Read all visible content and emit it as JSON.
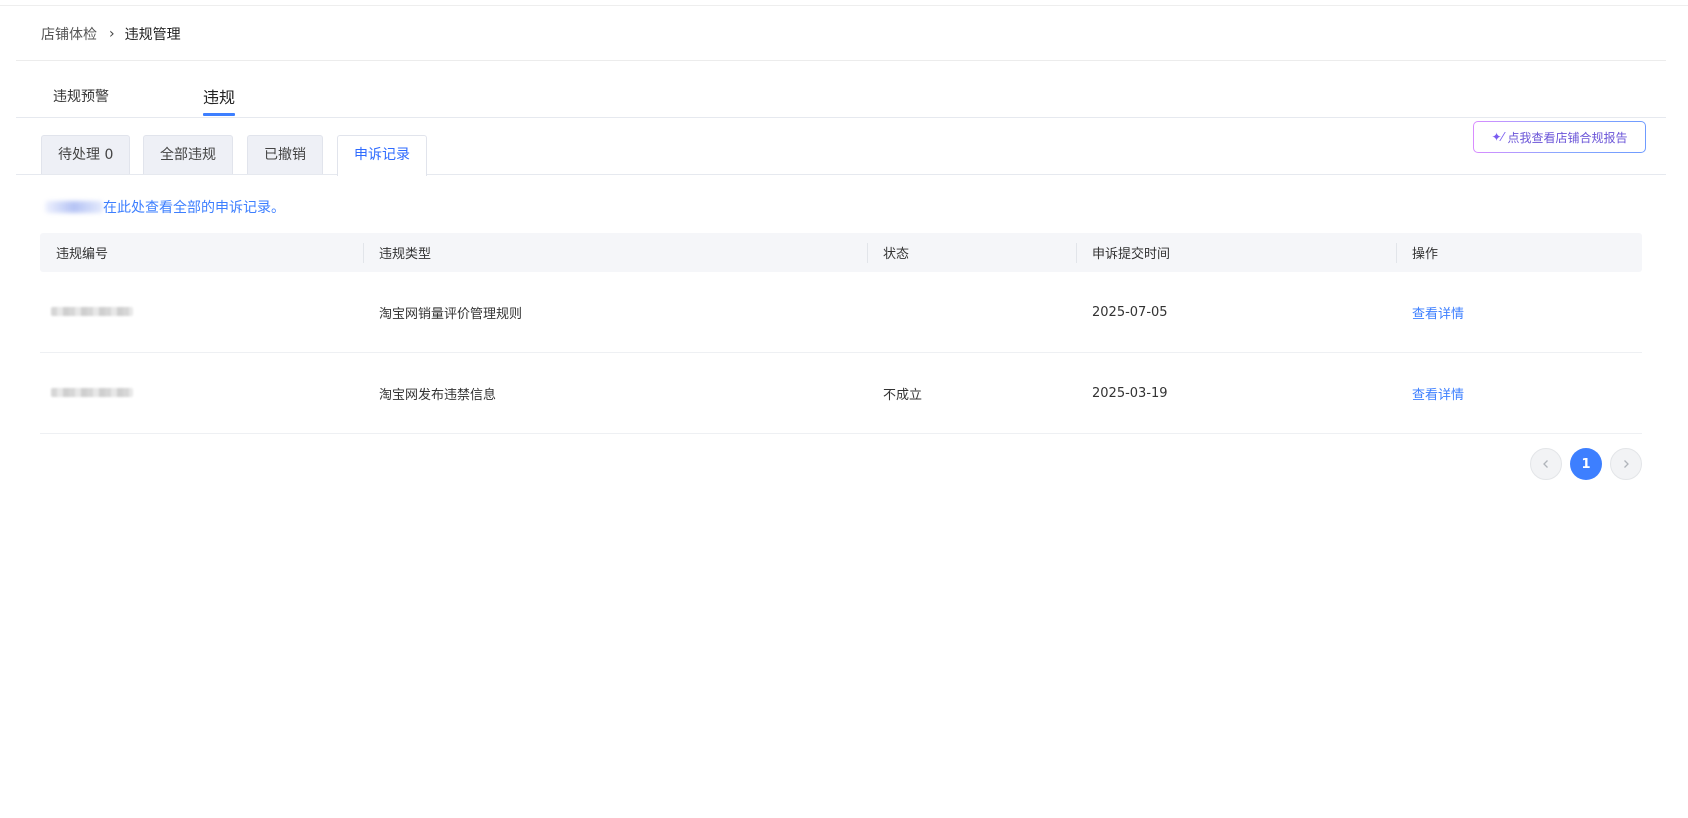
{
  "breadcrumb": {
    "parent": "店铺体检",
    "separator": "›",
    "current": "违规管理"
  },
  "main_tabs": [
    {
      "label": "违规预警",
      "active": false
    },
    {
      "label": "违规",
      "active": true
    }
  ],
  "sub_tabs": [
    {
      "label": "待处理 0",
      "active": false
    },
    {
      "label": "全部违规",
      "active": false
    },
    {
      "label": "已撤销",
      "active": false
    },
    {
      "label": "申诉记录",
      "active": true
    }
  ],
  "report_button": {
    "icon": "sparkle-wand-icon",
    "label": "点我查看店铺合规报告"
  },
  "notice": {
    "text": "在此处查看全部的申诉记录。"
  },
  "table": {
    "columns": [
      "违规编号",
      "违规类型",
      "状态",
      "申诉提交时间",
      "操作"
    ],
    "rows": [
      {
        "violation_type": "淘宝网销量评价管理规则",
        "status": "",
        "submit_time": "2025-07-05",
        "action": "查看详情"
      },
      {
        "violation_type": "淘宝网发布违禁信息",
        "status": "不成立",
        "submit_time": "2025-03-19",
        "action": "查看详情"
      }
    ]
  },
  "pagination": {
    "prev_icon": "chevron-left-icon",
    "current_page": "1",
    "next_icon": "chevron-right-icon"
  },
  "colors": {
    "accent": "#3d7fff",
    "tab_bg": "#eef0f6",
    "header_bg": "#f5f6f9"
  }
}
